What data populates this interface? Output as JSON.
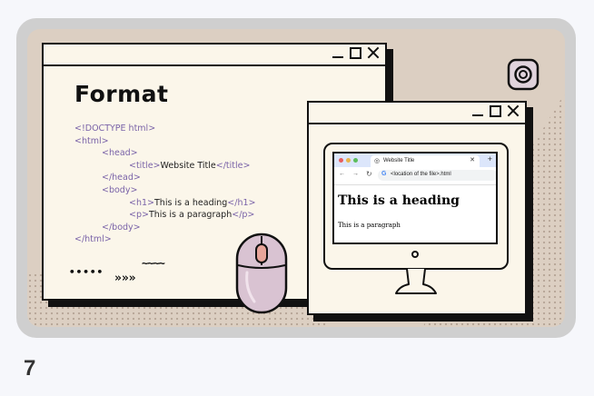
{
  "slide_number": "7",
  "format_window": {
    "title": "Format",
    "code_lines": [
      {
        "indent": 0,
        "pre": "<!DOCTYPE html>",
        "text": "",
        "post": ""
      },
      {
        "indent": 0,
        "pre": "<html>",
        "text": "",
        "post": ""
      },
      {
        "indent": 1,
        "pre": "<head>",
        "text": "",
        "post": ""
      },
      {
        "indent": 2,
        "pre": "<title>",
        "text": "Website Title",
        "post": "</title>"
      },
      {
        "indent": 1,
        "pre": "</head>",
        "text": "",
        "post": ""
      },
      {
        "indent": 1,
        "pre": "<body>",
        "text": "",
        "post": ""
      },
      {
        "indent": 2,
        "pre": "<h1>",
        "text": "This is a heading",
        "post": "</h1>"
      },
      {
        "indent": 2,
        "pre": "<p>",
        "text": "This is a paragraph",
        "post": "</p>"
      },
      {
        "indent": 1,
        "pre": "</body>",
        "text": "",
        "post": ""
      },
      {
        "indent": 0,
        "pre": "</html>",
        "text": "",
        "post": ""
      }
    ],
    "decor": {
      "dots": "•••••",
      "chevrons": "»»»",
      "wave": "~~~~"
    }
  },
  "browser": {
    "tab_title": "Website Title",
    "address": "<location of the file>.html",
    "page_heading": "This is a heading",
    "page_paragraph": "This is a paragraph"
  },
  "colors": {
    "background": "#dccfc2",
    "window": "#fbf6ea",
    "tag": "#7a63a8",
    "mouse": "#d9c3d2",
    "frame": "#cfcfcf"
  },
  "icons": [
    "minimize-icon",
    "maximize-icon",
    "close-icon",
    "instagram-icon",
    "mouse-icon",
    "monitor-icon",
    "reload-icon",
    "google-icon"
  ]
}
